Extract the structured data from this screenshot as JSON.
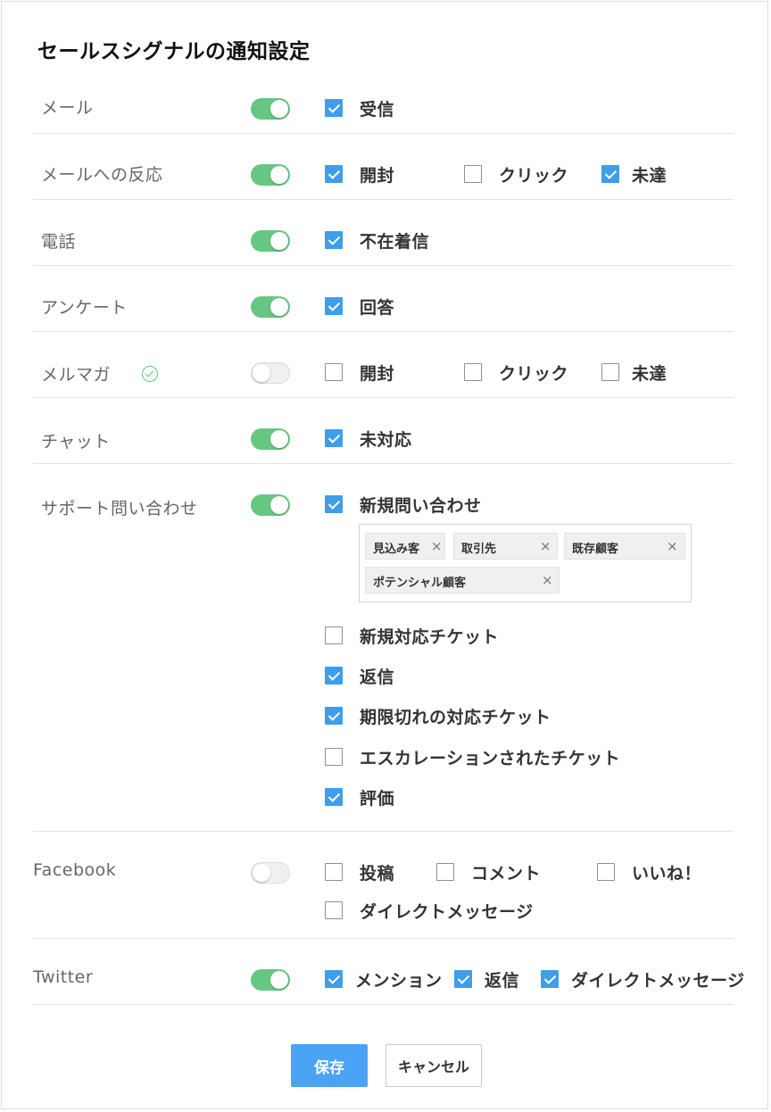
{
  "title": "セールスシグナルの通知設定",
  "colors": {
    "accent": "#3d9eeb",
    "toggle_on": "#66c782",
    "save_button": "#4aa3f5"
  },
  "rows": {
    "mail": {
      "label": "メール",
      "toggle": "on",
      "options": [
        {
          "label": "受信",
          "checked": true
        }
      ]
    },
    "mail_reaction": {
      "label": "メールへの反応",
      "toggle": "on",
      "options": [
        {
          "label": "開封",
          "checked": true
        },
        {
          "label": "クリック",
          "checked": false
        },
        {
          "label": "未達",
          "checked": true
        }
      ]
    },
    "phone": {
      "label": "電話",
      "toggle": "on",
      "options": [
        {
          "label": "不在着信",
          "checked": true
        }
      ]
    },
    "survey": {
      "label": "アンケート",
      "toggle": "on",
      "options": [
        {
          "label": "回答",
          "checked": true
        }
      ]
    },
    "newsletter": {
      "label": "メルマガ",
      "verified_icon": "check-circle-icon",
      "toggle": "off",
      "options": [
        {
          "label": "開封",
          "checked": false
        },
        {
          "label": "クリック",
          "checked": false
        },
        {
          "label": "未達",
          "checked": false
        }
      ]
    },
    "chat": {
      "label": "チャット",
      "toggle": "on",
      "options": [
        {
          "label": "未対応",
          "checked": true
        }
      ]
    },
    "support": {
      "label": "サポート問い合わせ",
      "toggle": "on",
      "options": [
        {
          "label": "新規問い合わせ",
          "checked": true
        },
        {
          "label": "新規対応チケット",
          "checked": false
        },
        {
          "label": "返信",
          "checked": true
        },
        {
          "label": "期限切れの対応チケット",
          "checked": true
        },
        {
          "label": "エスカレーションされたチケット",
          "checked": false
        },
        {
          "label": "評価",
          "checked": true
        }
      ],
      "tags": [
        "見込み客",
        "取引先",
        "既存顧客",
        "ポテンシャル顧客"
      ],
      "tag_remove_glyph": "×"
    },
    "facebook": {
      "label": "Facebook",
      "toggle": "off",
      "options": [
        {
          "label": "投稿",
          "checked": false
        },
        {
          "label": "コメント",
          "checked": false
        },
        {
          "label": "いいね！",
          "checked": false
        },
        {
          "label": "ダイレクトメッセージ",
          "checked": false
        }
      ]
    },
    "twitter": {
      "label": "Twitter",
      "toggle": "on",
      "options": [
        {
          "label": "メンション",
          "checked": true
        },
        {
          "label": "返信",
          "checked": true
        },
        {
          "label": "ダイレクトメッセージ",
          "checked": true
        }
      ]
    }
  },
  "buttons": {
    "save": "保存",
    "cancel": "キャンセル"
  }
}
